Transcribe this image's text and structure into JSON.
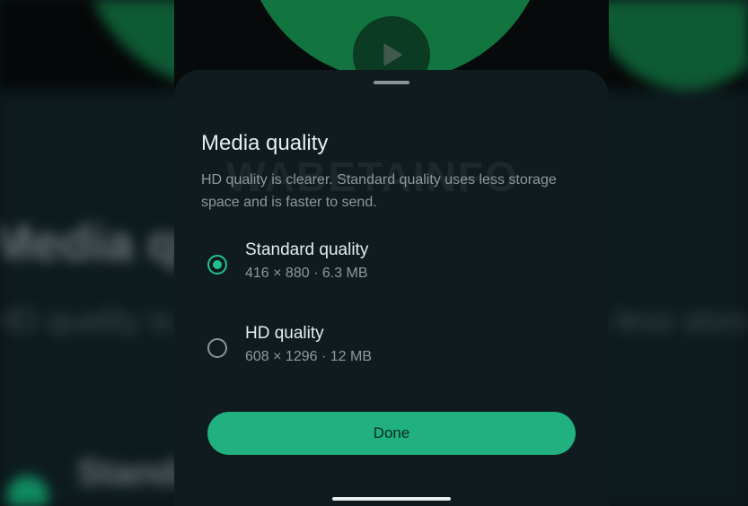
{
  "sheet": {
    "title": "Media quality",
    "description": "HD quality is clearer. Standard quality uses less storage space and is faster to send.",
    "options": [
      {
        "label": "Standard quality",
        "detail": "416 × 880 · 6.3 MB",
        "selected": true
      },
      {
        "label": "HD quality",
        "detail": "608 × 1296 · 12 MB",
        "selected": false
      }
    ],
    "done_label": "Done"
  },
  "watermark": "WABETAINFO",
  "colors": {
    "accent": "#21b07f",
    "radio_selected": "#21c08b",
    "sheet_background": "#0f1b1f",
    "video_background": "#12753f"
  },
  "icons": {
    "video": "play-icon"
  }
}
